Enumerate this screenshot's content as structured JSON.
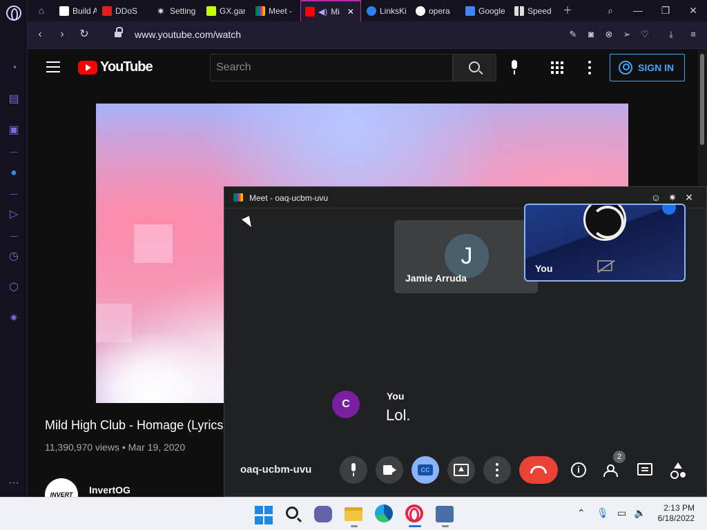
{
  "tabs": [
    {
      "label": "Build A",
      "icon": "roblox-icon"
    },
    {
      "label": "DDoS",
      "icon": "youtube-icon"
    },
    {
      "label": "Setting",
      "icon": "gear-icon"
    },
    {
      "label": "GX.gar",
      "icon": "gx-icon"
    },
    {
      "label": "Meet -",
      "icon": "meet-icon"
    },
    {
      "label": "Mi",
      "icon": "youtube-icon"
    },
    {
      "label": "LinksKi",
      "icon": "links-icon"
    },
    {
      "label": "opera",
      "icon": "globe-icon"
    },
    {
      "label": "Google",
      "icon": "google-translate-icon"
    },
    {
      "label": "Speed",
      "icon": "speed-dial-icon"
    }
  ],
  "address": {
    "url": "www.youtube.com/watch"
  },
  "youtube": {
    "logo_text": "YouTube",
    "search_placeholder": "Search",
    "sign_in": "SIGN IN",
    "video_title": "Mild High Club - Homage (Lyrics)",
    "views": "11,390,970 views",
    "date": "Mar 19, 2020",
    "channel_name": "InvertOG",
    "channel_avatar_text": "INVERT"
  },
  "meet": {
    "window_title": "Meet - oaq-ucbm-uvu",
    "meeting_code": "oaq-ucbm-uvu",
    "participants": [
      {
        "name": "Jamie Arruda",
        "initial": "J"
      },
      {
        "name": "You"
      }
    ],
    "chat": {
      "sender_initial": "C",
      "sender": "You",
      "message": "Lol."
    },
    "people_count": "2",
    "cc_label": "CC"
  },
  "taskbar": {
    "time": "2:13 PM",
    "date": "6/18/2022"
  },
  "colors": {
    "opera_accent": "#b82ea6",
    "youtube_red": "#ff0000",
    "signin_blue": "#3ea6ff",
    "meet_hangup": "#ea4335",
    "meet_cc": "#8ab4f8"
  }
}
